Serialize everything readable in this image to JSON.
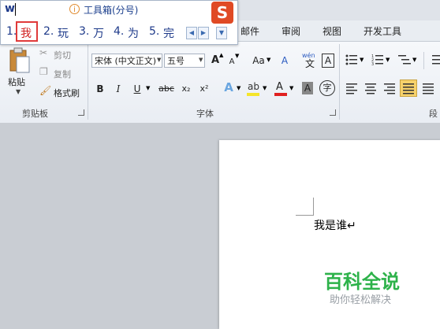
{
  "ime": {
    "input": "w",
    "hint": "工具箱(分号)",
    "candidates": [
      {
        "index": "1.",
        "text": "我"
      },
      {
        "index": "2.",
        "text": "玩"
      },
      {
        "index": "3.",
        "text": "万"
      },
      {
        "index": "4.",
        "text": "为"
      },
      {
        "index": "5.",
        "text": "完"
      }
    ],
    "logo": "S"
  },
  "tabs": [
    "邮件",
    "审阅",
    "视图",
    "开发工具"
  ],
  "clipboard": {
    "paste": "粘贴",
    "cut": "剪切",
    "copy": "复制",
    "format_painter": "格式刷",
    "group_label": "剪贴板"
  },
  "font": {
    "font_name": "宋体 (中文正文)",
    "font_size": "五号",
    "group_label": "字体",
    "bold": "B",
    "italic": "I",
    "underline": "U",
    "strike": "abc",
    "subscript": "x₂",
    "superscript": "x²",
    "grow": "A",
    "shrink": "A",
    "change_case": "Aa",
    "clear_format": "A",
    "phonetic": "wén",
    "phonetic_char": "文",
    "border_char": "A",
    "enclose_char": "字",
    "text_effect": "A",
    "font_color": "A",
    "char_shading": "A"
  },
  "paragraph": {
    "group_label": "段"
  },
  "document": {
    "text": "我是谁↵"
  },
  "watermark": {
    "title": "百科全说",
    "subtitle": "助你轻松解决"
  },
  "colors": {
    "accent_red": "#e03a3a",
    "ime_blue": "#1e3a8a",
    "watermark_green": "#2db24a"
  }
}
